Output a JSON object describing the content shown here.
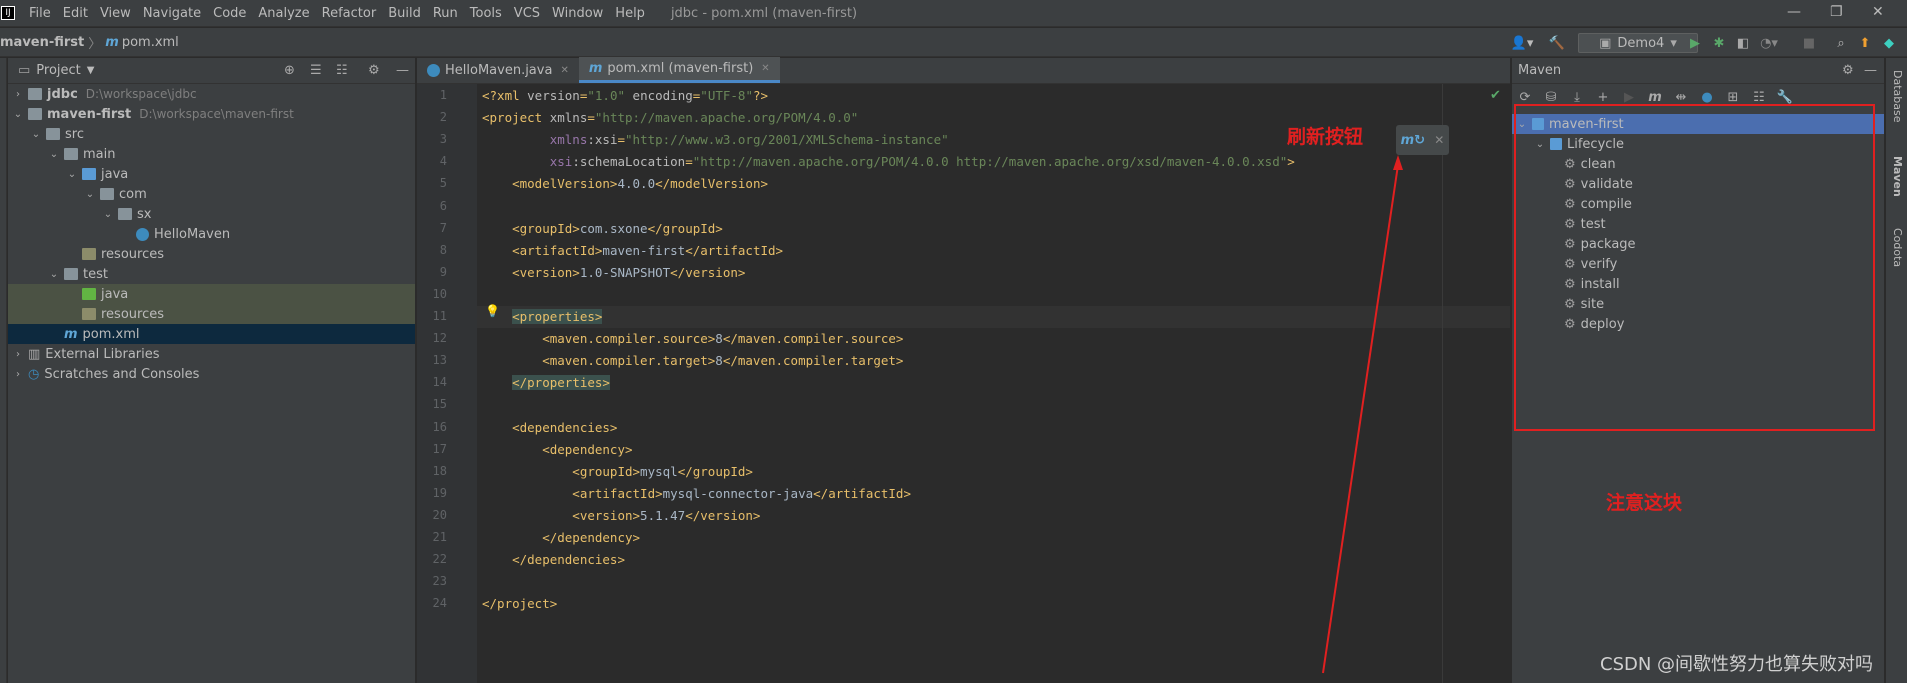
{
  "menu": [
    "File",
    "Edit",
    "View",
    "Navigate",
    "Code",
    "Analyze",
    "Refactor",
    "Build",
    "Run",
    "Tools",
    "VCS",
    "Window",
    "Help"
  ],
  "window_title": "jdbc - pom.xml (maven-first)",
  "breadcrumb": {
    "project": "maven-first",
    "sep": "〉",
    "file": "pom.xml"
  },
  "toolbar": {
    "run_config": "Demo4"
  },
  "project_panel": {
    "title": "Project",
    "tree": [
      {
        "label": "jdbc",
        "path": "D:\\workspace\\jdbc",
        "depth": 0,
        "arrow": "›",
        "icon": "module"
      },
      {
        "label": "maven-first",
        "path": "D:\\workspace\\maven-first",
        "depth": 0,
        "arrow": "⌄",
        "icon": "module"
      },
      {
        "label": "src",
        "depth": 1,
        "arrow": "⌄",
        "icon": "folder"
      },
      {
        "label": "main",
        "depth": 2,
        "arrow": "⌄",
        "icon": "folder"
      },
      {
        "label": "java",
        "depth": 3,
        "arrow": "⌄",
        "icon": "folder-blue"
      },
      {
        "label": "com",
        "depth": 4,
        "arrow": "⌄",
        "icon": "folder"
      },
      {
        "label": "sx",
        "depth": 5,
        "arrow": "⌄",
        "icon": "folder"
      },
      {
        "label": "HelloMaven",
        "depth": 6,
        "arrow": "",
        "icon": "class"
      },
      {
        "label": "resources",
        "depth": 3,
        "arrow": "",
        "icon": "folder-res"
      },
      {
        "label": "test",
        "depth": 2,
        "arrow": "⌄",
        "icon": "folder"
      },
      {
        "label": "java",
        "depth": 3,
        "arrow": "",
        "icon": "folder-green",
        "highlight": true
      },
      {
        "label": "resources",
        "depth": 3,
        "arrow": "",
        "icon": "folder-res",
        "highlight": true
      },
      {
        "label": "pom.xml",
        "depth": 2,
        "arrow": "",
        "icon": "maven",
        "selected": true
      },
      {
        "label": "External Libraries",
        "depth": 0,
        "arrow": "›",
        "icon": "lib"
      },
      {
        "label": "Scratches and Consoles",
        "depth": 0,
        "arrow": "›",
        "icon": "scratch"
      }
    ]
  },
  "tabs": [
    {
      "label": "HelloMaven.java",
      "active": false
    },
    {
      "label": "pom.xml (maven-first)",
      "active": true
    }
  ],
  "code_lines": [
    "<?xml version=\"1.0\" encoding=\"UTF-8\"?>",
    "<project xmlns=\"http://maven.apache.org/POM/4.0.0\"",
    "         xmlns:xsi=\"http://www.w3.org/2001/XMLSchema-instance\"",
    "         xsi:schemaLocation=\"http://maven.apache.org/POM/4.0.0 http://maven.apache.org/xsd/maven-4.0.0.xsd\">",
    "    <modelVersion>4.0.0</modelVersion>",
    "",
    "    <groupId>com.sxone</groupId>",
    "    <artifactId>maven-first</artifactId>",
    "    <version>1.0-SNAPSHOT</version>",
    "",
    "    <properties>",
    "        <maven.compiler.source>8</maven.compiler.source>",
    "        <maven.compiler.target>8</maven.compiler.target>",
    "    </properties>",
    "",
    "    <dependencies>",
    "        <dependency>",
    "            <groupId>mysql</groupId>",
    "            <artifactId>mysql-connector-java</artifactId>",
    "            <version>5.1.47</version>",
    "        </dependency>",
    "    </dependencies>",
    "",
    "</project>"
  ],
  "line_numbers": [
    "1",
    "2",
    "3",
    "4",
    "5",
    "6",
    "7",
    "8",
    "9",
    "10",
    "11",
    "12",
    "13",
    "14",
    "15",
    "16",
    "17",
    "18",
    "19",
    "20",
    "21",
    "22",
    "23",
    "24"
  ],
  "current_line": 11,
  "maven_panel": {
    "title": "Maven",
    "project": "maven-first",
    "lifecycle": "Lifecycle",
    "goals": [
      "clean",
      "validate",
      "compile",
      "test",
      "package",
      "verify",
      "install",
      "site",
      "deploy"
    ]
  },
  "right_strip": [
    "Database",
    "Maven",
    "Codota"
  ],
  "annotations": {
    "refresh": "刷新按钮",
    "note": "注意这块"
  },
  "watermark": "CSDN @间歇性努力也算失败对吗",
  "colors": {
    "annotation": "#e02020",
    "selection": "#4b6eaf"
  }
}
